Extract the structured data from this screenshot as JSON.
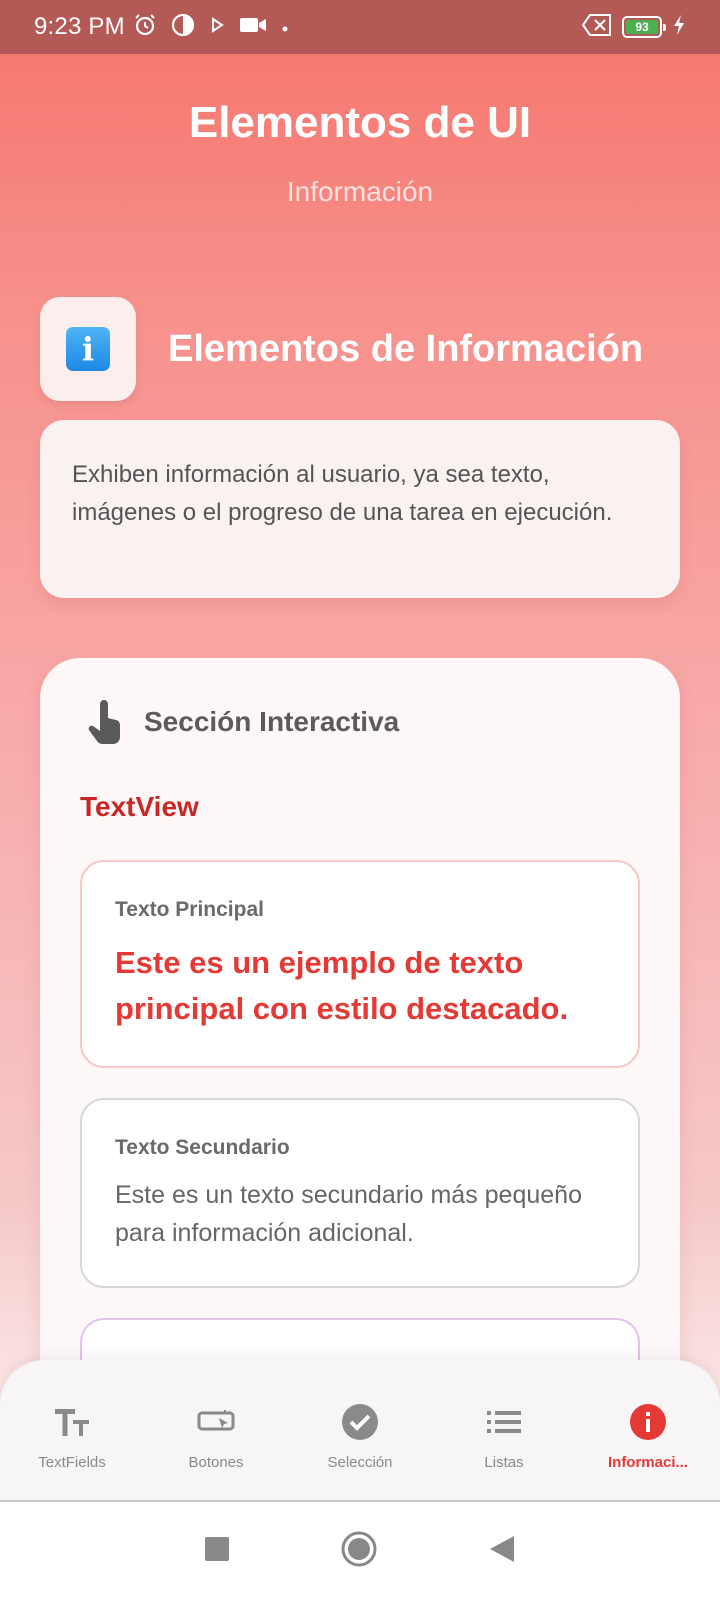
{
  "status_bar": {
    "time": "9:23 PM",
    "icons": [
      "alarm-icon",
      "pie-icon",
      "play-icon",
      "video-icon",
      "dot-icon"
    ],
    "battery_level": "93"
  },
  "header": {
    "title": "Elementos de UI",
    "subtitle": "Información"
  },
  "section": {
    "title": "Elementos de Información",
    "icon": "info-icon"
  },
  "description": {
    "text": "Exhiben información al usuario, ya sea texto, imágenes o el progreso de una tarea en ejecución."
  },
  "interactive": {
    "title": "Sección Interactiva",
    "icon": "touch-hand-icon",
    "textview_label": "TextView",
    "primary": {
      "label": "Texto Principal",
      "text": "Este es un ejemplo de texto principal con estilo destacado."
    },
    "secondary": {
      "label": "Texto Secundario",
      "text": "Este es un texto secundario más pequeño para información adicional."
    }
  },
  "bottom_nav": {
    "items": [
      {
        "label": "TextFields",
        "icon": "text-fields-icon"
      },
      {
        "label": "Botones",
        "icon": "button-icon"
      },
      {
        "label": "Selección",
        "icon": "check-circle-icon"
      },
      {
        "label": "Listas",
        "icon": "list-icon"
      },
      {
        "label": "Informaci...",
        "icon": "info-circle-icon",
        "active": true
      }
    ]
  },
  "colors": {
    "accent": "#e53935",
    "status_bar": "#b45a56"
  }
}
